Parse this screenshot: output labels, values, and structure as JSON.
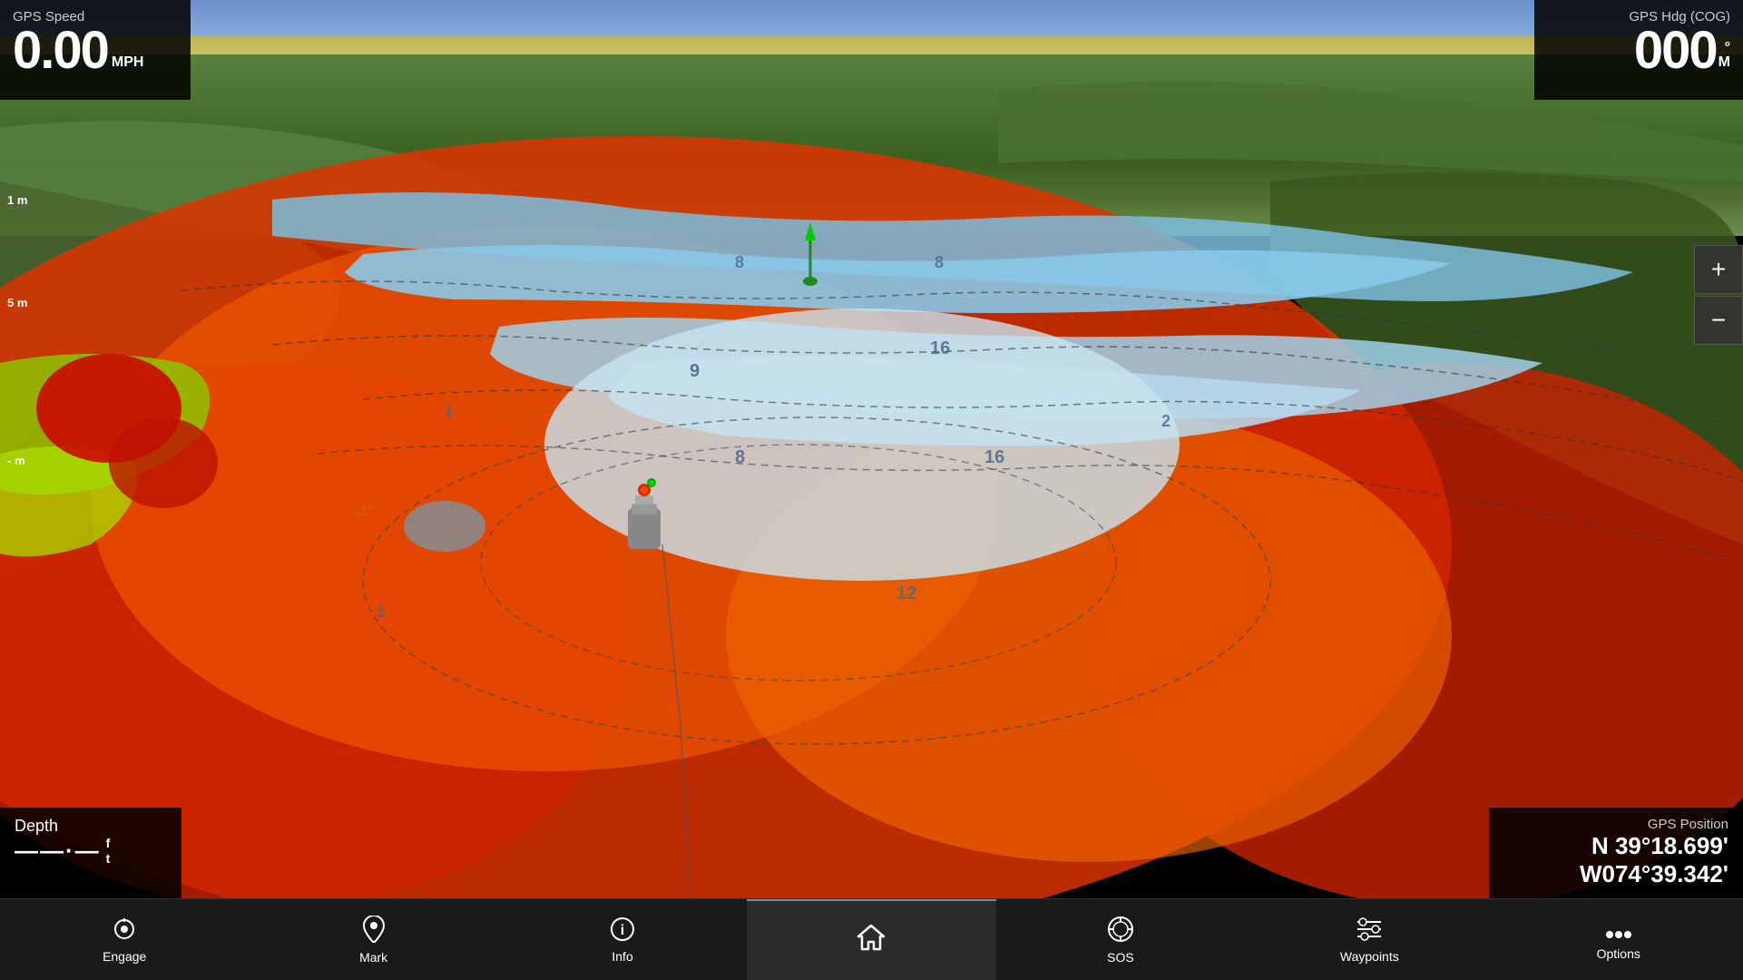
{
  "gps_speed": {
    "title": "GPS Speed",
    "value": "0.00",
    "unit": "MPH"
  },
  "gps_hdg": {
    "title": "GPS Hdg (COG)",
    "value": "000",
    "unit_deg": "°",
    "unit_m": "M"
  },
  "depth": {
    "title": "Depth",
    "value": "---.-",
    "unit_ft": "f",
    "unit_t": "t"
  },
  "gps_position": {
    "title": "GPS Position",
    "lat": "N  39°18.699'",
    "lon": "W074°39.342'"
  },
  "scale_labels": [
    {
      "id": "s1",
      "text": "1 m"
    },
    {
      "id": "s2",
      "text": "5 m"
    },
    {
      "id": "s3",
      "text": "- m"
    }
  ],
  "depth_numbers": [
    {
      "id": "d1",
      "text": "9"
    },
    {
      "id": "d2",
      "text": "8"
    },
    {
      "id": "d3",
      "text": "8"
    },
    {
      "id": "d4",
      "text": "16"
    },
    {
      "id": "d5",
      "text": "16"
    },
    {
      "id": "d6",
      "text": "12"
    },
    {
      "id": "d7",
      "text": "2"
    },
    {
      "id": "d8",
      "text": "1"
    },
    {
      "id": "d9",
      "text": "1"
    }
  ],
  "zoom": {
    "plus_label": "+",
    "minus_label": "−"
  },
  "nav": {
    "items": [
      {
        "id": "engage",
        "label": "Engage",
        "icon": "⊙"
      },
      {
        "id": "mark",
        "label": "Mark",
        "icon": "📍"
      },
      {
        "id": "info",
        "label": "Info",
        "icon": "ℹ"
      },
      {
        "id": "home",
        "label": "",
        "icon": "⌂"
      },
      {
        "id": "sos",
        "label": "SOS",
        "icon": "⊕"
      },
      {
        "id": "waypoints",
        "label": "Waypoints",
        "icon": "≡"
      },
      {
        "id": "options",
        "label": "Options",
        "icon": "•••"
      }
    ]
  }
}
